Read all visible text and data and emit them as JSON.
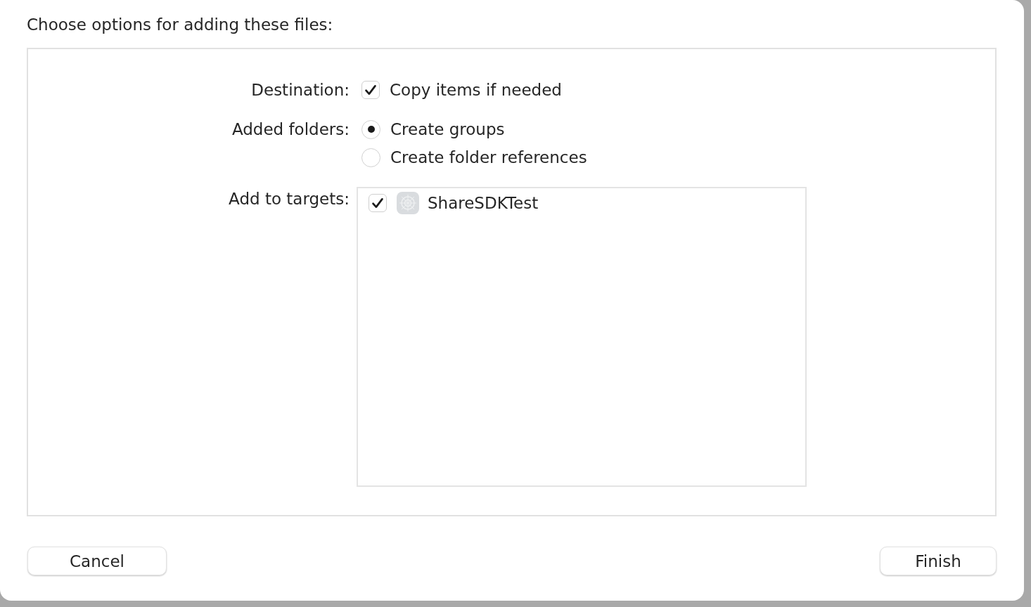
{
  "dialog": {
    "title": "Choose options for adding these files:"
  },
  "options": [
    {
      "label": "Destination:",
      "controls": [
        {
          "kind": "checkbox",
          "text": "Copy items if needed",
          "checked": true
        }
      ]
    },
    {
      "label": "Added folders:",
      "controls": [
        {
          "kind": "radio",
          "text": "Create groups",
          "selected": true
        },
        {
          "kind": "radio",
          "text": "Create folder references",
          "selected": false
        }
      ]
    }
  ],
  "targets": {
    "label": "Add to targets:",
    "items": [
      {
        "name": "ShareSDKTest",
        "checked": true
      }
    ]
  },
  "buttons": [
    {
      "label": "Cancel"
    },
    {
      "label": "Finish"
    }
  ]
}
